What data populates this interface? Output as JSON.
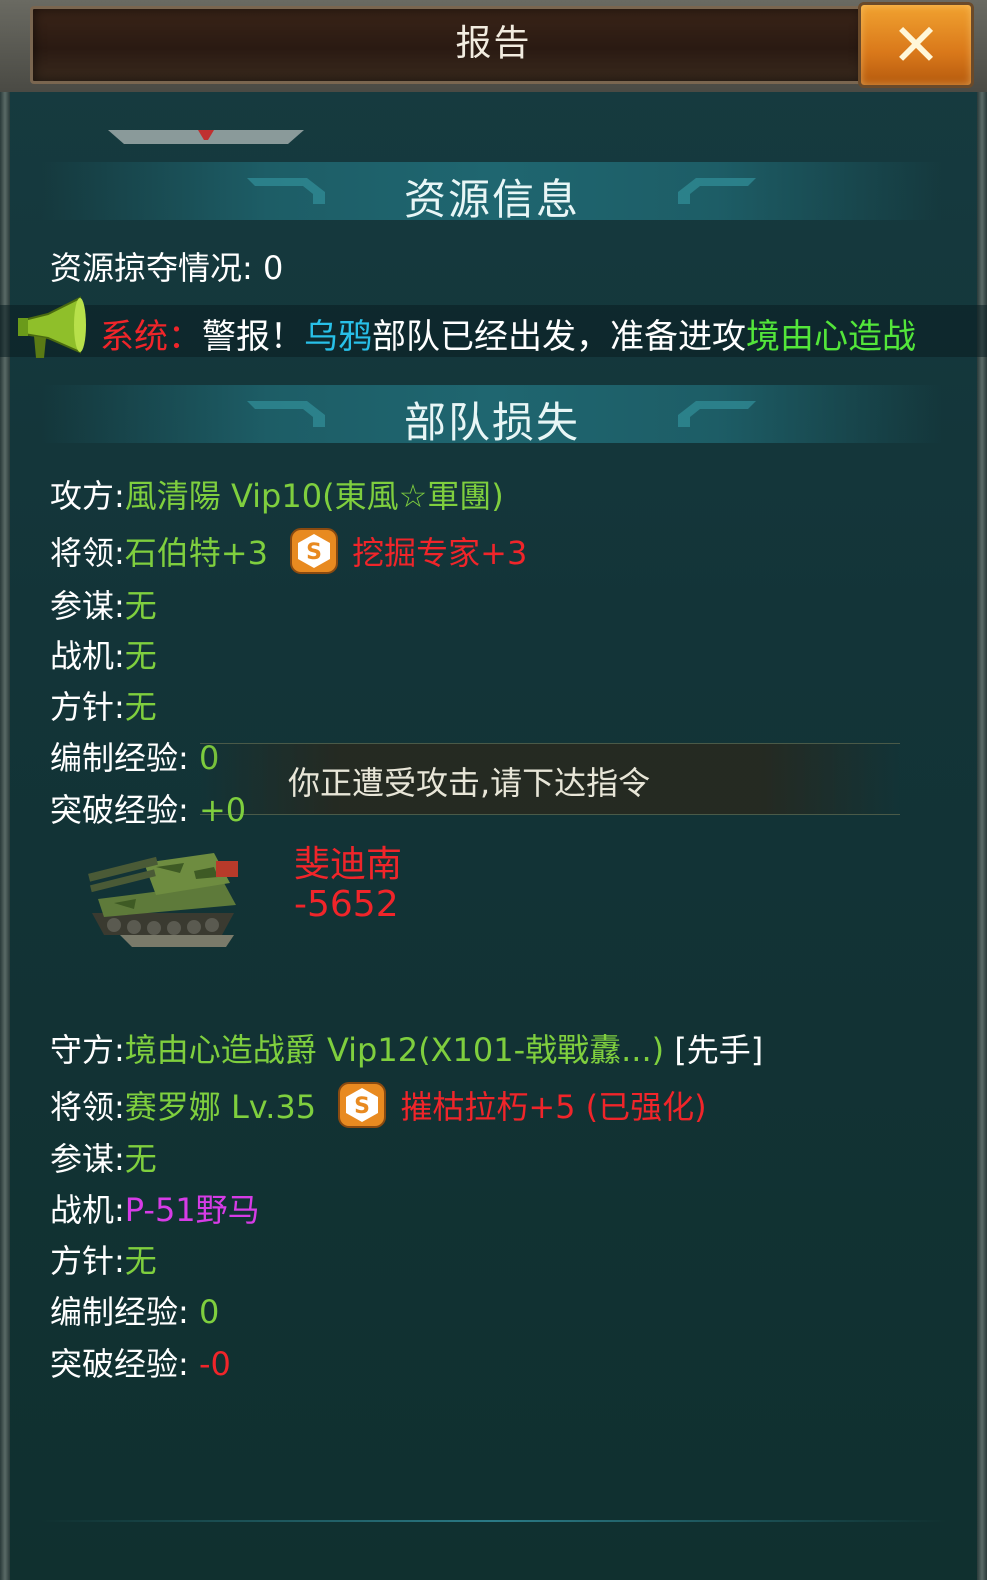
{
  "header": {
    "title": "报告",
    "close_label": "✕"
  },
  "resource_section": {
    "title": "资源信息",
    "plunder_label": "资源掠夺情况: ",
    "plunder_value": "0"
  },
  "ticker": {
    "prefix": "系统：",
    "alert": "警报！",
    "troop": "乌鸦",
    "mid": "部队已经出发，准备进攻",
    "target": "境由心造战"
  },
  "loss_section": {
    "title": "部队损失"
  },
  "attacker": {
    "side_label": "攻方:",
    "name": "風清陽 Vip10",
    "guild": "(東風☆軍團)",
    "general_label": "将领:",
    "general": "石伯特+3",
    "skill": "挖掘专家+3",
    "advisor_label": "参谋:",
    "advisor": "无",
    "fighter_label": "战机:",
    "fighter": "无",
    "strategy_label": "方针:",
    "strategy": "无",
    "exp_label": "编制经验: ",
    "exp": "0",
    "break_label": "突破经验: ",
    "break_exp": "+0"
  },
  "toast": {
    "text": "你正遭受攻击,请下达指令"
  },
  "unit_loss": {
    "name": "斐迪南",
    "value": "-5652",
    "icon": "tank-icon"
  },
  "defender": {
    "side_label": "守方:",
    "name": "境由心造战爵 Vip12",
    "guild": "(X101-戟戰纛...)",
    "first": " [先手]",
    "general_label": "将领:",
    "general": "赛罗娜 Lv.35",
    "skill": "摧枯拉朽+5 (已强化)",
    "advisor_label": "参谋:",
    "advisor": "无",
    "fighter_label": "战机:",
    "fighter": "P-51野马",
    "strategy_label": "方针:",
    "strategy": "无",
    "exp_label": "编制经验: ",
    "exp": "0",
    "break_label": "突破经验: ",
    "break_exp": "-0"
  },
  "colors": {
    "accent_green": "#7fcf3e",
    "loss_red": "#f0252a",
    "troop_cyan": "#28c0e8",
    "fighter_magenta": "#d63ce6",
    "close_orange": "#d9781a"
  }
}
